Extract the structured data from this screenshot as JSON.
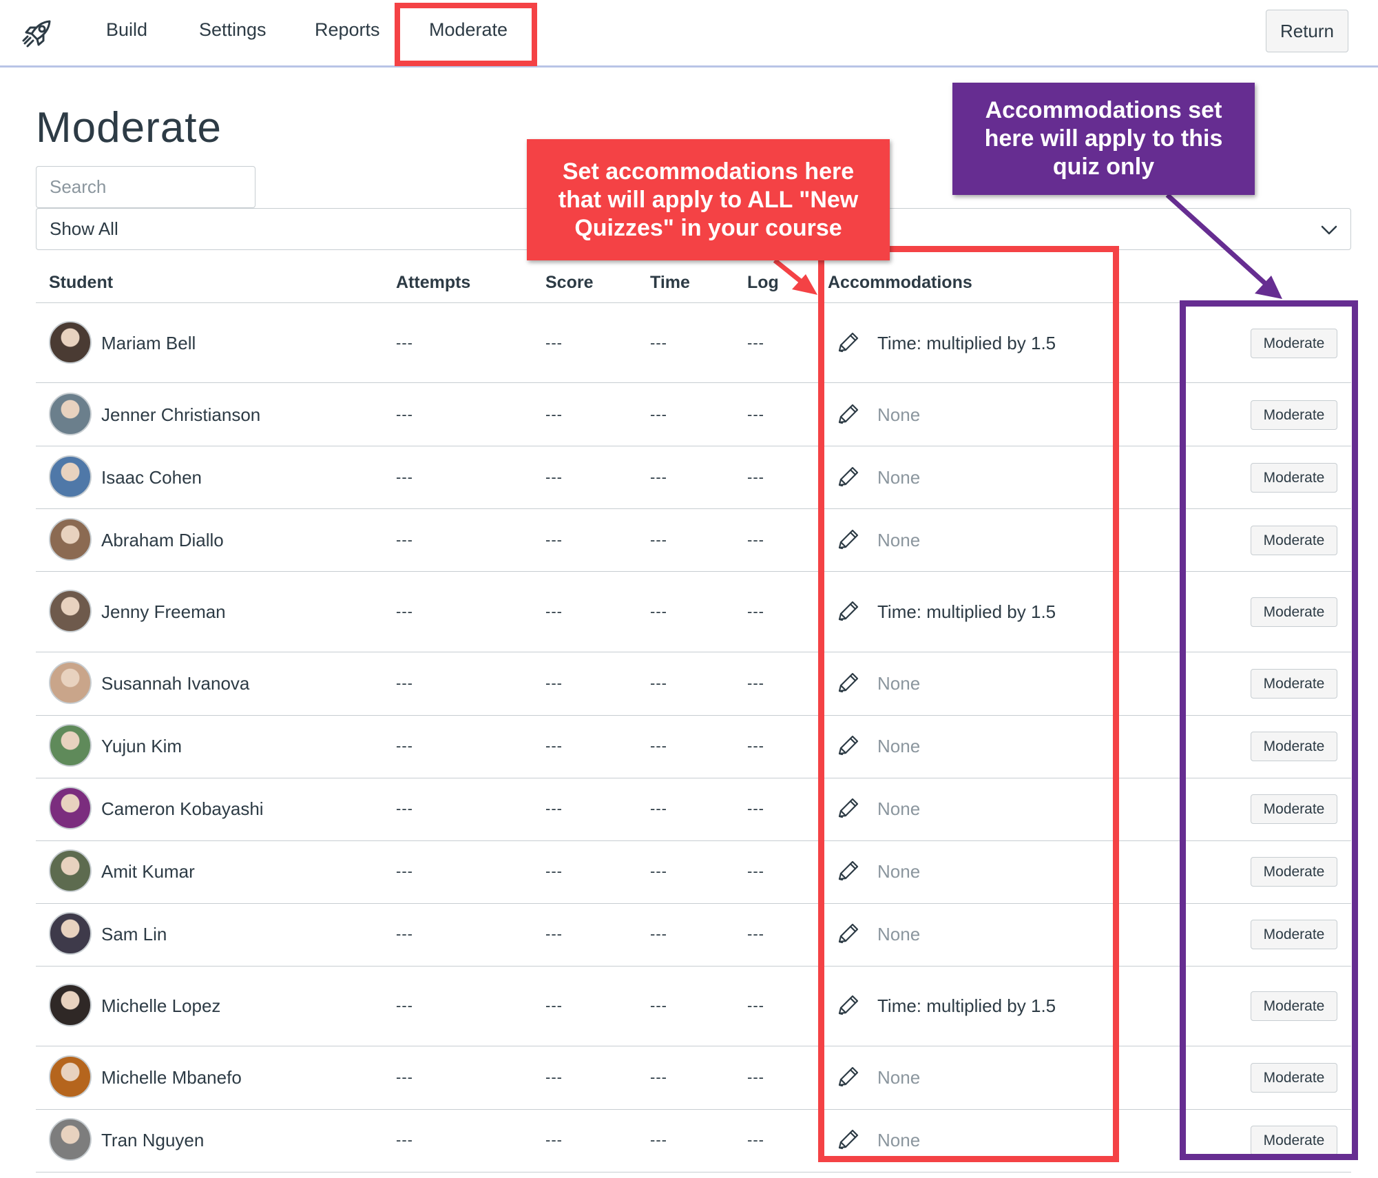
{
  "nav": {
    "items": [
      "Build",
      "Settings",
      "Reports",
      "Moderate"
    ],
    "active": "Moderate",
    "return_label": "Return"
  },
  "page": {
    "title": "Moderate",
    "search_placeholder": "Search",
    "filter_value": "Show All"
  },
  "table": {
    "headers": {
      "student": "Student",
      "attempts": "Attempts",
      "score": "Score",
      "time": "Time",
      "log": "Log",
      "accommodations": "Accommodations"
    },
    "empty_value": "---",
    "action_label": "Moderate",
    "rows": [
      {
        "name": "Mariam Bell",
        "accommodation": "Time: multiplied by 1.5",
        "avatar_color": "#4a3b33"
      },
      {
        "name": "Jenner Christianson",
        "accommodation": "None",
        "avatar_color": "#6b7f8c"
      },
      {
        "name": "Isaac Cohen",
        "accommodation": "None",
        "avatar_color": "#4f78a8"
      },
      {
        "name": "Abraham Diallo",
        "accommodation": "None",
        "avatar_color": "#8b6a52"
      },
      {
        "name": "Jenny Freeman",
        "accommodation": "Time: multiplied by 1.5",
        "avatar_color": "#6e5a4c"
      },
      {
        "name": "Susannah Ivanova",
        "accommodation": "None",
        "avatar_color": "#c9a58a"
      },
      {
        "name": "Yujun Kim",
        "accommodation": "None",
        "avatar_color": "#5f8a5a"
      },
      {
        "name": "Cameron Kobayashi",
        "accommodation": "None",
        "avatar_color": "#7b2d7e"
      },
      {
        "name": "Amit Kumar",
        "accommodation": "None",
        "avatar_color": "#5d6b4f"
      },
      {
        "name": "Sam Lin",
        "accommodation": "None",
        "avatar_color": "#3e3a4a"
      },
      {
        "name": "Michelle Lopez",
        "accommodation": "Time: multiplied by 1.5",
        "avatar_color": "#2f2826"
      },
      {
        "name": "Michelle Mbanefo",
        "accommodation": "None",
        "avatar_color": "#b5651d"
      },
      {
        "name": "Tran Nguyen",
        "accommodation": "None",
        "avatar_color": "#7d7d7d"
      }
    ]
  },
  "callouts": {
    "red_text": "Set accommodations here that will apply to ALL \"New Quizzes\" in your course",
    "purple_text": "Accommodations set here will apply to this quiz only",
    "red_color": "#f44245",
    "purple_color": "#662d91"
  },
  "icons": {
    "logo": "rocket-icon",
    "edit": "pencil-icon",
    "dropdown": "chevron-down-icon"
  }
}
